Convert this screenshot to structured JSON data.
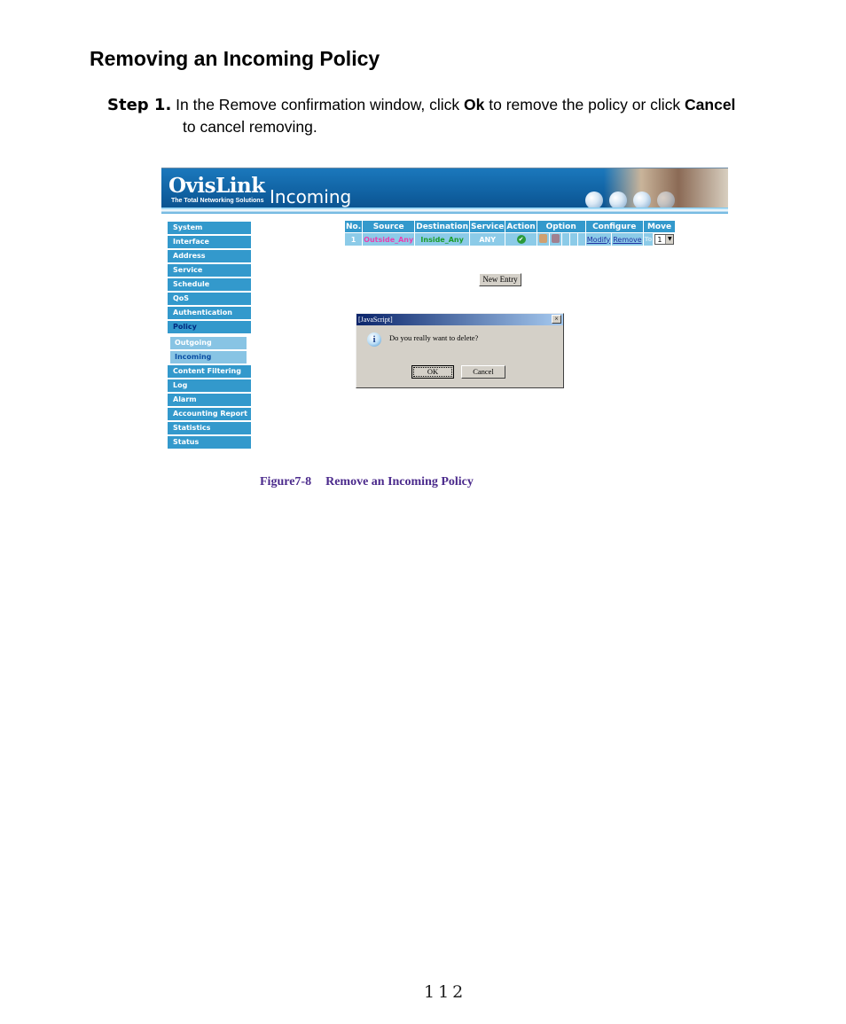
{
  "heading": "Removing an Incoming Policy",
  "step": {
    "label": "Step 1.",
    "text_1": " In the Remove confirmation window, click ",
    "bold_1": "Ok",
    "text_2": " to remove the policy or click ",
    "bold_2": "Cancel",
    "line_2": "to cancel removing."
  },
  "screenshot": {
    "banner": {
      "logo": "OvisLink",
      "logo_tagline": "The Total Networking Solutions",
      "title": "Incoming",
      "icons": [
        "globe-icon",
        "globe-icon",
        "globe-icon",
        "globe-icon"
      ]
    },
    "sidebar": {
      "items": [
        {
          "label": "System"
        },
        {
          "label": "Interface"
        },
        {
          "label": "Address"
        },
        {
          "label": "Service"
        },
        {
          "label": "Schedule"
        },
        {
          "label": "QoS"
        },
        {
          "label": "Authentication"
        },
        {
          "label": "Policy",
          "active": true
        }
      ],
      "sub_items": [
        {
          "label": "Outgoing"
        },
        {
          "label": "Incoming",
          "active": true
        }
      ],
      "items_after": [
        {
          "label": "Content Filtering"
        },
        {
          "label": "Log"
        },
        {
          "label": "Alarm"
        },
        {
          "label": "Accounting Report"
        },
        {
          "label": "Statistics"
        },
        {
          "label": "Status"
        }
      ]
    },
    "policy_table": {
      "columns": [
        "No.",
        "Source",
        "Destination",
        "Service",
        "Action",
        "Option",
        "Configure",
        "Move"
      ],
      "rows": [
        {
          "no": "1",
          "source": "Outside_Any",
          "destination": "Inside_Any",
          "service": "ANY",
          "action_icon": "permit-check-icon",
          "option_icons": [
            "log-icon",
            "statistics-icon"
          ],
          "configure": [
            "Modify",
            "Remove"
          ],
          "move_to_label": "To",
          "move_value": "1"
        }
      ]
    },
    "new_entry_button": "New Entry",
    "dialog": {
      "title": "[JavaScript]",
      "close": "×",
      "icon": "i",
      "message": "Do you really want to delete?",
      "ok": "OK",
      "cancel": "Cancel"
    }
  },
  "caption": {
    "figure": "Figure7-8",
    "title": "Remove an Incoming Policy"
  },
  "page_number": "112"
}
